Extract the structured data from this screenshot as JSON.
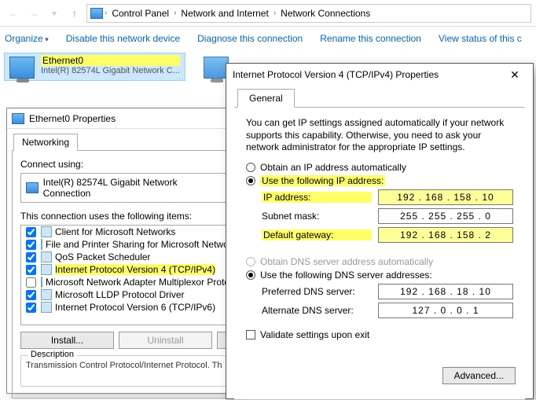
{
  "addressbar": {
    "crumbs": [
      "Control Panel",
      "Network and Internet",
      "Network Connections"
    ]
  },
  "cmdbar": {
    "organize": "Organize",
    "disable": "Disable this network device",
    "diagnose": "Diagnose this connection",
    "rename": "Rename this connection",
    "viewstatus": "View status of this c"
  },
  "connections": [
    {
      "name": "Ethernet0",
      "sub": "Intel(R) 82574L Gigabit Network C..."
    }
  ],
  "ethprops": {
    "title": "Ethernet0 Properties",
    "tab": "Networking",
    "connect_using_label": "Connect using:",
    "adapter": "Intel(R) 82574L Gigabit Network Connection",
    "items_label": "This connection uses the following items:",
    "items": [
      {
        "label": "Client for Microsoft Networks",
        "checked": true
      },
      {
        "label": "File and Printer Sharing for Microsoft Network",
        "checked": true
      },
      {
        "label": "QoS Packet Scheduler",
        "checked": true
      },
      {
        "label": "Internet Protocol Version 4 (TCP/IPv4)",
        "checked": true,
        "highlight": true
      },
      {
        "label": "Microsoft Network Adapter Multiplexor Proto",
        "checked": false
      },
      {
        "label": "Microsoft LLDP Protocol Driver",
        "checked": true
      },
      {
        "label": "Internet Protocol Version 6 (TCP/IPv6)",
        "checked": true
      }
    ],
    "install": "Install...",
    "uninstall": "Uninstall",
    "desc_label": "Description",
    "desc_text": "Transmission Control Protocol/Internet Protocol. Th"
  },
  "ipv4": {
    "title": "Internet Protocol Version 4 (TCP/IPv4) Properties",
    "tab": "General",
    "intro": "You can get IP settings assigned automatically if your network supports this capability. Otherwise, you need to ask your network administrator for the appropriate IP settings.",
    "obtain_auto": "Obtain an IP address automatically",
    "use_following": "Use the following IP address:",
    "ip_label": "IP address:",
    "ip_value": "192 . 168 . 158 . 10",
    "mask_label": "Subnet mask:",
    "mask_value": "255 . 255 . 255 .  0",
    "gw_label": "Default gateway:",
    "gw_value": "192 . 168 . 158 .  2",
    "dns_auto": "Obtain DNS server address automatically",
    "dns_use": "Use the following DNS server addresses:",
    "dns1_label": "Preferred DNS server:",
    "dns1_value": "192 . 168 .  18 .  10",
    "dns2_label": "Alternate DNS server:",
    "dns2_value": "127 .  0  .  0  .  1",
    "validate": "Validate settings upon exit",
    "advanced": "Advanced..."
  }
}
